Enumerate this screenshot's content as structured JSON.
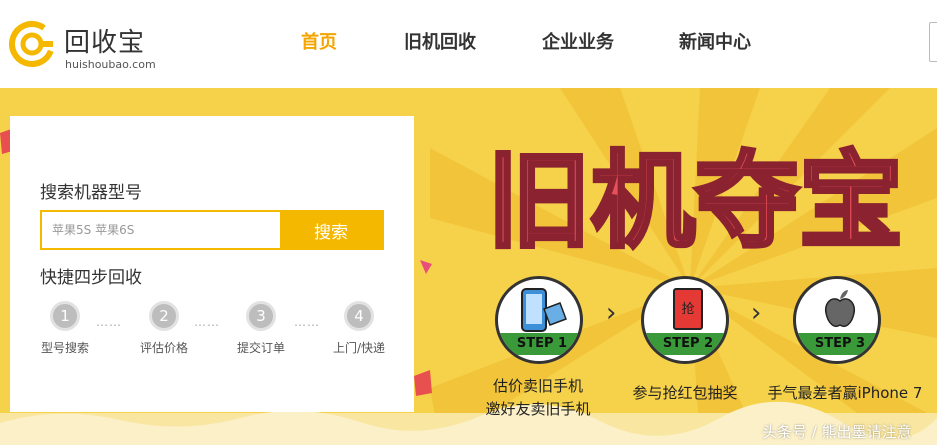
{
  "header": {
    "logo_name": "回收宝",
    "logo_domain": "huishoubao.com",
    "nav": [
      {
        "label": "首页",
        "active": true
      },
      {
        "label": "旧机回收",
        "active": false
      },
      {
        "label": "企业业务",
        "active": false
      },
      {
        "label": "新闻中心",
        "active": false
      }
    ]
  },
  "search_panel": {
    "title": "搜索机器型号",
    "input_placeholder": "苹果5S 苹果6S",
    "button_label": "搜索",
    "steps_title": "快捷四步回收",
    "steps": [
      {
        "number": "1",
        "label": "型号搜索"
      },
      {
        "number": "2",
        "label": "评估价格"
      },
      {
        "number": "3",
        "label": "提交订单"
      },
      {
        "number": "4",
        "label": "上门/快递"
      }
    ],
    "dots": "……"
  },
  "promo": {
    "title": "旧机夺宝",
    "steps": [
      {
        "band": "STEP 1",
        "icon": "phone-sale-icon",
        "lines": [
          "估价卖旧手机",
          "邀好友卖旧手机"
        ]
      },
      {
        "band": "STEP 2",
        "icon": "red-envelope-icon",
        "envelope_char": "抢",
        "lines": [
          "参与抢红包抽奖"
        ]
      },
      {
        "band": "STEP 3",
        "icon": "apple-icon",
        "lines": [
          "手气最差者赢iPhone 7"
        ]
      }
    ],
    "step_arrow": "›"
  },
  "watermark": "头条号 / 熊出墨请注意",
  "colors": {
    "accent": "#f5b800",
    "nav_active": "#f5a500",
    "banner": "#f6d24a",
    "step_band": "#3a9a3a",
    "title_red": "#e8505b"
  }
}
